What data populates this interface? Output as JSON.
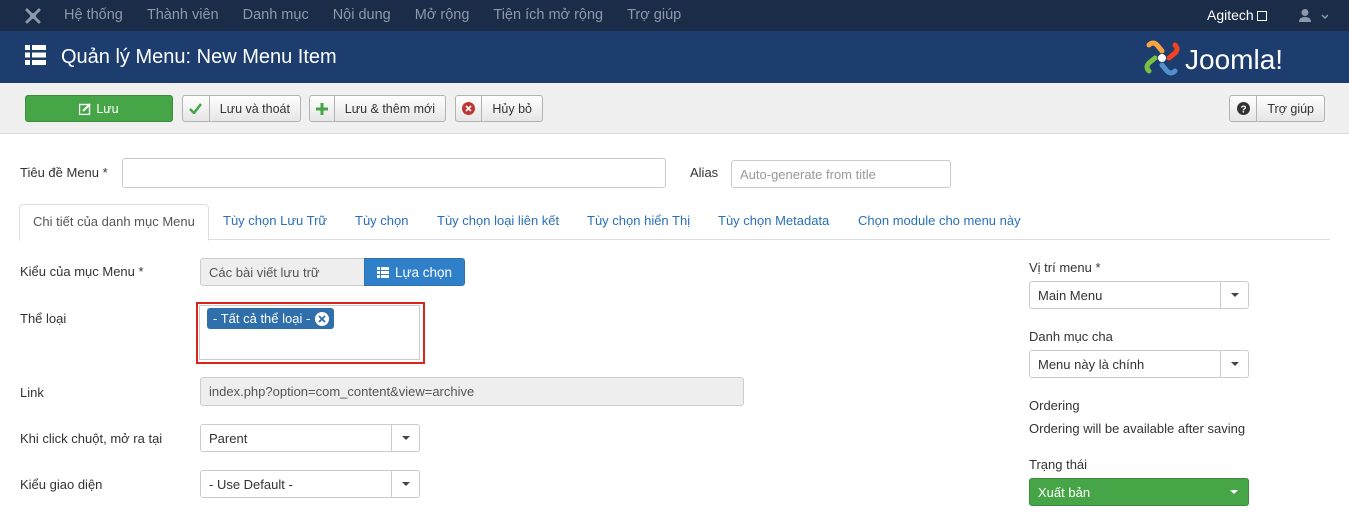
{
  "topnav": {
    "items": [
      "Hệ thống",
      "Thành viên",
      "Danh mục",
      "Nội dung",
      "Mở rộng",
      "Tiện ích mở rộng",
      "Trợ giúp"
    ],
    "site_name": "Agitech",
    "logo_icon": "joomla-icon",
    "user_icon": "user-icon"
  },
  "header": {
    "title": "Quản lý Menu: New Menu Item",
    "brand": "Joomla!"
  },
  "toolbar": {
    "save_label": "Lưu",
    "save_close_label": "Lưu và thoát",
    "save_new_label": "Lưu & thêm mới",
    "cancel_label": "Hủy bỏ",
    "help_label": "Trợ giúp"
  },
  "form": {
    "title_label": "Tiêu đề Menu *",
    "title_value": "",
    "alias_label": "Alias",
    "alias_placeholder": "Auto-generate from title"
  },
  "tabs": [
    "Chi tiết của danh mục Menu",
    "Tùy chọn Lưu Trữ",
    "Tùy chọn",
    "Tùy chọn loại liên kết",
    "Tùy chọn hiển Thị",
    "Tùy chọn Metadata",
    "Chọn module cho menu này"
  ],
  "details": {
    "menu_type_label": "Kiểu của mục Menu *",
    "menu_type_value": "Các bài viết lưu trữ",
    "choose_label": "Lựa chọn",
    "category_label": "Thể loại",
    "category_tag": "- Tất cả thể loại -",
    "link_label": "Link",
    "link_value": "index.php?option=com_content&view=archive",
    "target_label": "Khi click chuột, mở ra tại",
    "target_value": "Parent",
    "template_label": "Kiểu giao diện",
    "template_value": "- Use Default -"
  },
  "sidebar": {
    "menu_location_label": "Vị trí menu *",
    "menu_location_value": "Main Menu",
    "parent_label": "Danh mục cha",
    "parent_value": "Menu này là chính",
    "ordering_label": "Ordering",
    "ordering_note": "Ordering will be available after saving",
    "status_label": "Trạng thái",
    "status_value": "Xuất bản"
  },
  "colors": {
    "topnav_bg": "#1a2c48",
    "header_bg": "#1c3d6e",
    "save_green": "#46a546",
    "primary_blue": "#2f80c8",
    "highlight_red": "#d9261c"
  }
}
